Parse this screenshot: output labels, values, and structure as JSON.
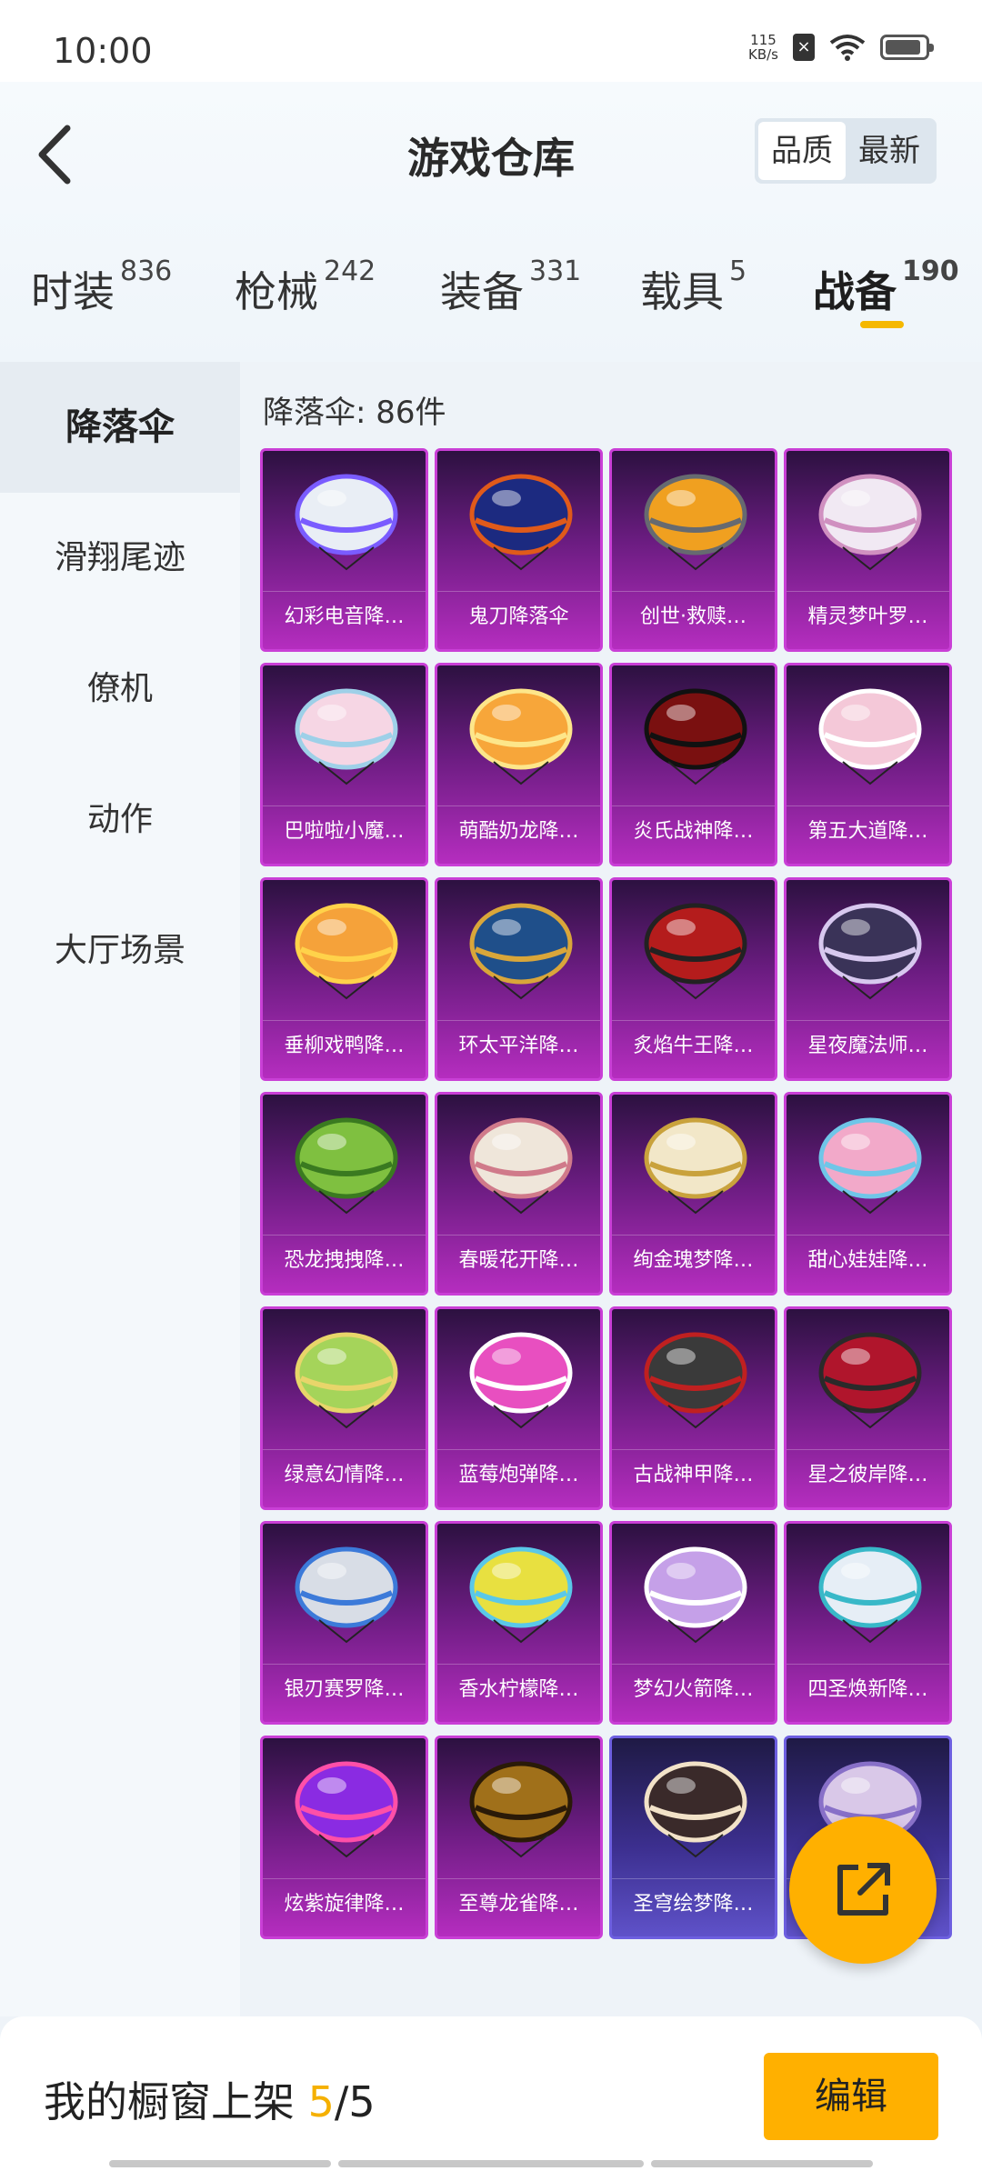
{
  "status_bar": {
    "time": "10:00",
    "net_speed_value": "115",
    "net_speed_unit": "KB/s"
  },
  "header": {
    "title": "游戏仓库",
    "sort_options": [
      "品质",
      "最新"
    ],
    "sort_selected": "品质"
  },
  "category_tabs": [
    {
      "label": "时装",
      "count": "836"
    },
    {
      "label": "枪械",
      "count": "242"
    },
    {
      "label": "装备",
      "count": "331"
    },
    {
      "label": "载具",
      "count": "5"
    },
    {
      "label": "战备",
      "count": "190",
      "active": true
    }
  ],
  "sidebar": {
    "items": [
      "降落伞",
      "滑翔尾迹",
      "僚机",
      "动作",
      "大厅场景"
    ],
    "active": "降落伞"
  },
  "content": {
    "count_label": "降落伞: 86件",
    "items": [
      {
        "name": "幻彩电音降…",
        "color": "#e9eef5",
        "accent": "#7a5cff"
      },
      {
        "name": "鬼刀降落伞",
        "color": "#1c2a80",
        "accent": "#e05a1a"
      },
      {
        "name": "创世·救赎…",
        "color": "#f0a020",
        "accent": "#666a70"
      },
      {
        "name": "精灵梦叶罗…",
        "color": "#f1e9f3",
        "accent": "#d090c0"
      },
      {
        "name": "巴啦啦小魔…",
        "color": "#f6d6e4",
        "accent": "#9ed0e8"
      },
      {
        "name": "萌酷奶龙降…",
        "color": "#f7a63a",
        "accent": "#fde68a"
      },
      {
        "name": "炎氏战神降…",
        "color": "#7a1010",
        "accent": "#111111"
      },
      {
        "name": "第五大道降…",
        "color": "#f4c8d8",
        "accent": "#ffffff"
      },
      {
        "name": "垂柳戏鸭降…",
        "color": "#f5a23a",
        "accent": "#ffd24a"
      },
      {
        "name": "环太平洋降…",
        "color": "#1f4f8a",
        "accent": "#d9a63a"
      },
      {
        "name": "炙焰牛王降…",
        "color": "#b41c1c",
        "accent": "#222222"
      },
      {
        "name": "星夜魔法师…",
        "color": "#3a3358",
        "accent": "#d7c8ef"
      },
      {
        "name": "恐龙拽拽降…",
        "color": "#7fc040",
        "accent": "#3a7a20"
      },
      {
        "name": "春暖花开降…",
        "color": "#efe6da",
        "accent": "#d07a8a"
      },
      {
        "name": "绚金瑰梦降…",
        "color": "#f2e7c8",
        "accent": "#c9a23c"
      },
      {
        "name": "甜心娃娃降…",
        "color": "#f2a9c9",
        "accent": "#6fc6e8"
      },
      {
        "name": "绿意幻情降…",
        "color": "#a5d45a",
        "accent": "#e8d56a"
      },
      {
        "name": "蓝莓炮弹降…",
        "color": "#e84fc0",
        "accent": "#ffffff"
      },
      {
        "name": "古战神甲降…",
        "color": "#3a3a3a",
        "accent": "#c02020"
      },
      {
        "name": "星之彼岸降…",
        "color": "#b0152c",
        "accent": "#2a2a2a"
      },
      {
        "name": "银刃赛罗降…",
        "color": "#d8dde6",
        "accent": "#3c7ad9"
      },
      {
        "name": "香水柠檬降…",
        "color": "#e8e040",
        "accent": "#5ac8e8"
      },
      {
        "name": "梦幻火箭降…",
        "color": "#c5a0e8",
        "accent": "#ffffff"
      },
      {
        "name": "四圣焕新降…",
        "color": "#e6eef6",
        "accent": "#38b8c8"
      },
      {
        "name": "炫紫旋律降…",
        "color": "#8a2be2",
        "accent": "#ff4fa8"
      },
      {
        "name": "至尊龙雀降…",
        "color": "#a0701a",
        "accent": "#2a1a08"
      },
      {
        "name": "圣穹绘梦降…",
        "color": "#3a2a2a",
        "accent": "#f2e2c8"
      },
      {
        "name": "",
        "color": "#d9c8e8",
        "accent": "#8870c8"
      }
    ]
  },
  "bottom_bar": {
    "showcase_label": "我的橱窗上架",
    "showcase_current": "5",
    "showcase_total": "/5",
    "edit_label": "编辑"
  },
  "colors": {
    "accent": "#ffb000",
    "card_purple": "#b52dbf",
    "card_blue": "#5f52c9"
  }
}
